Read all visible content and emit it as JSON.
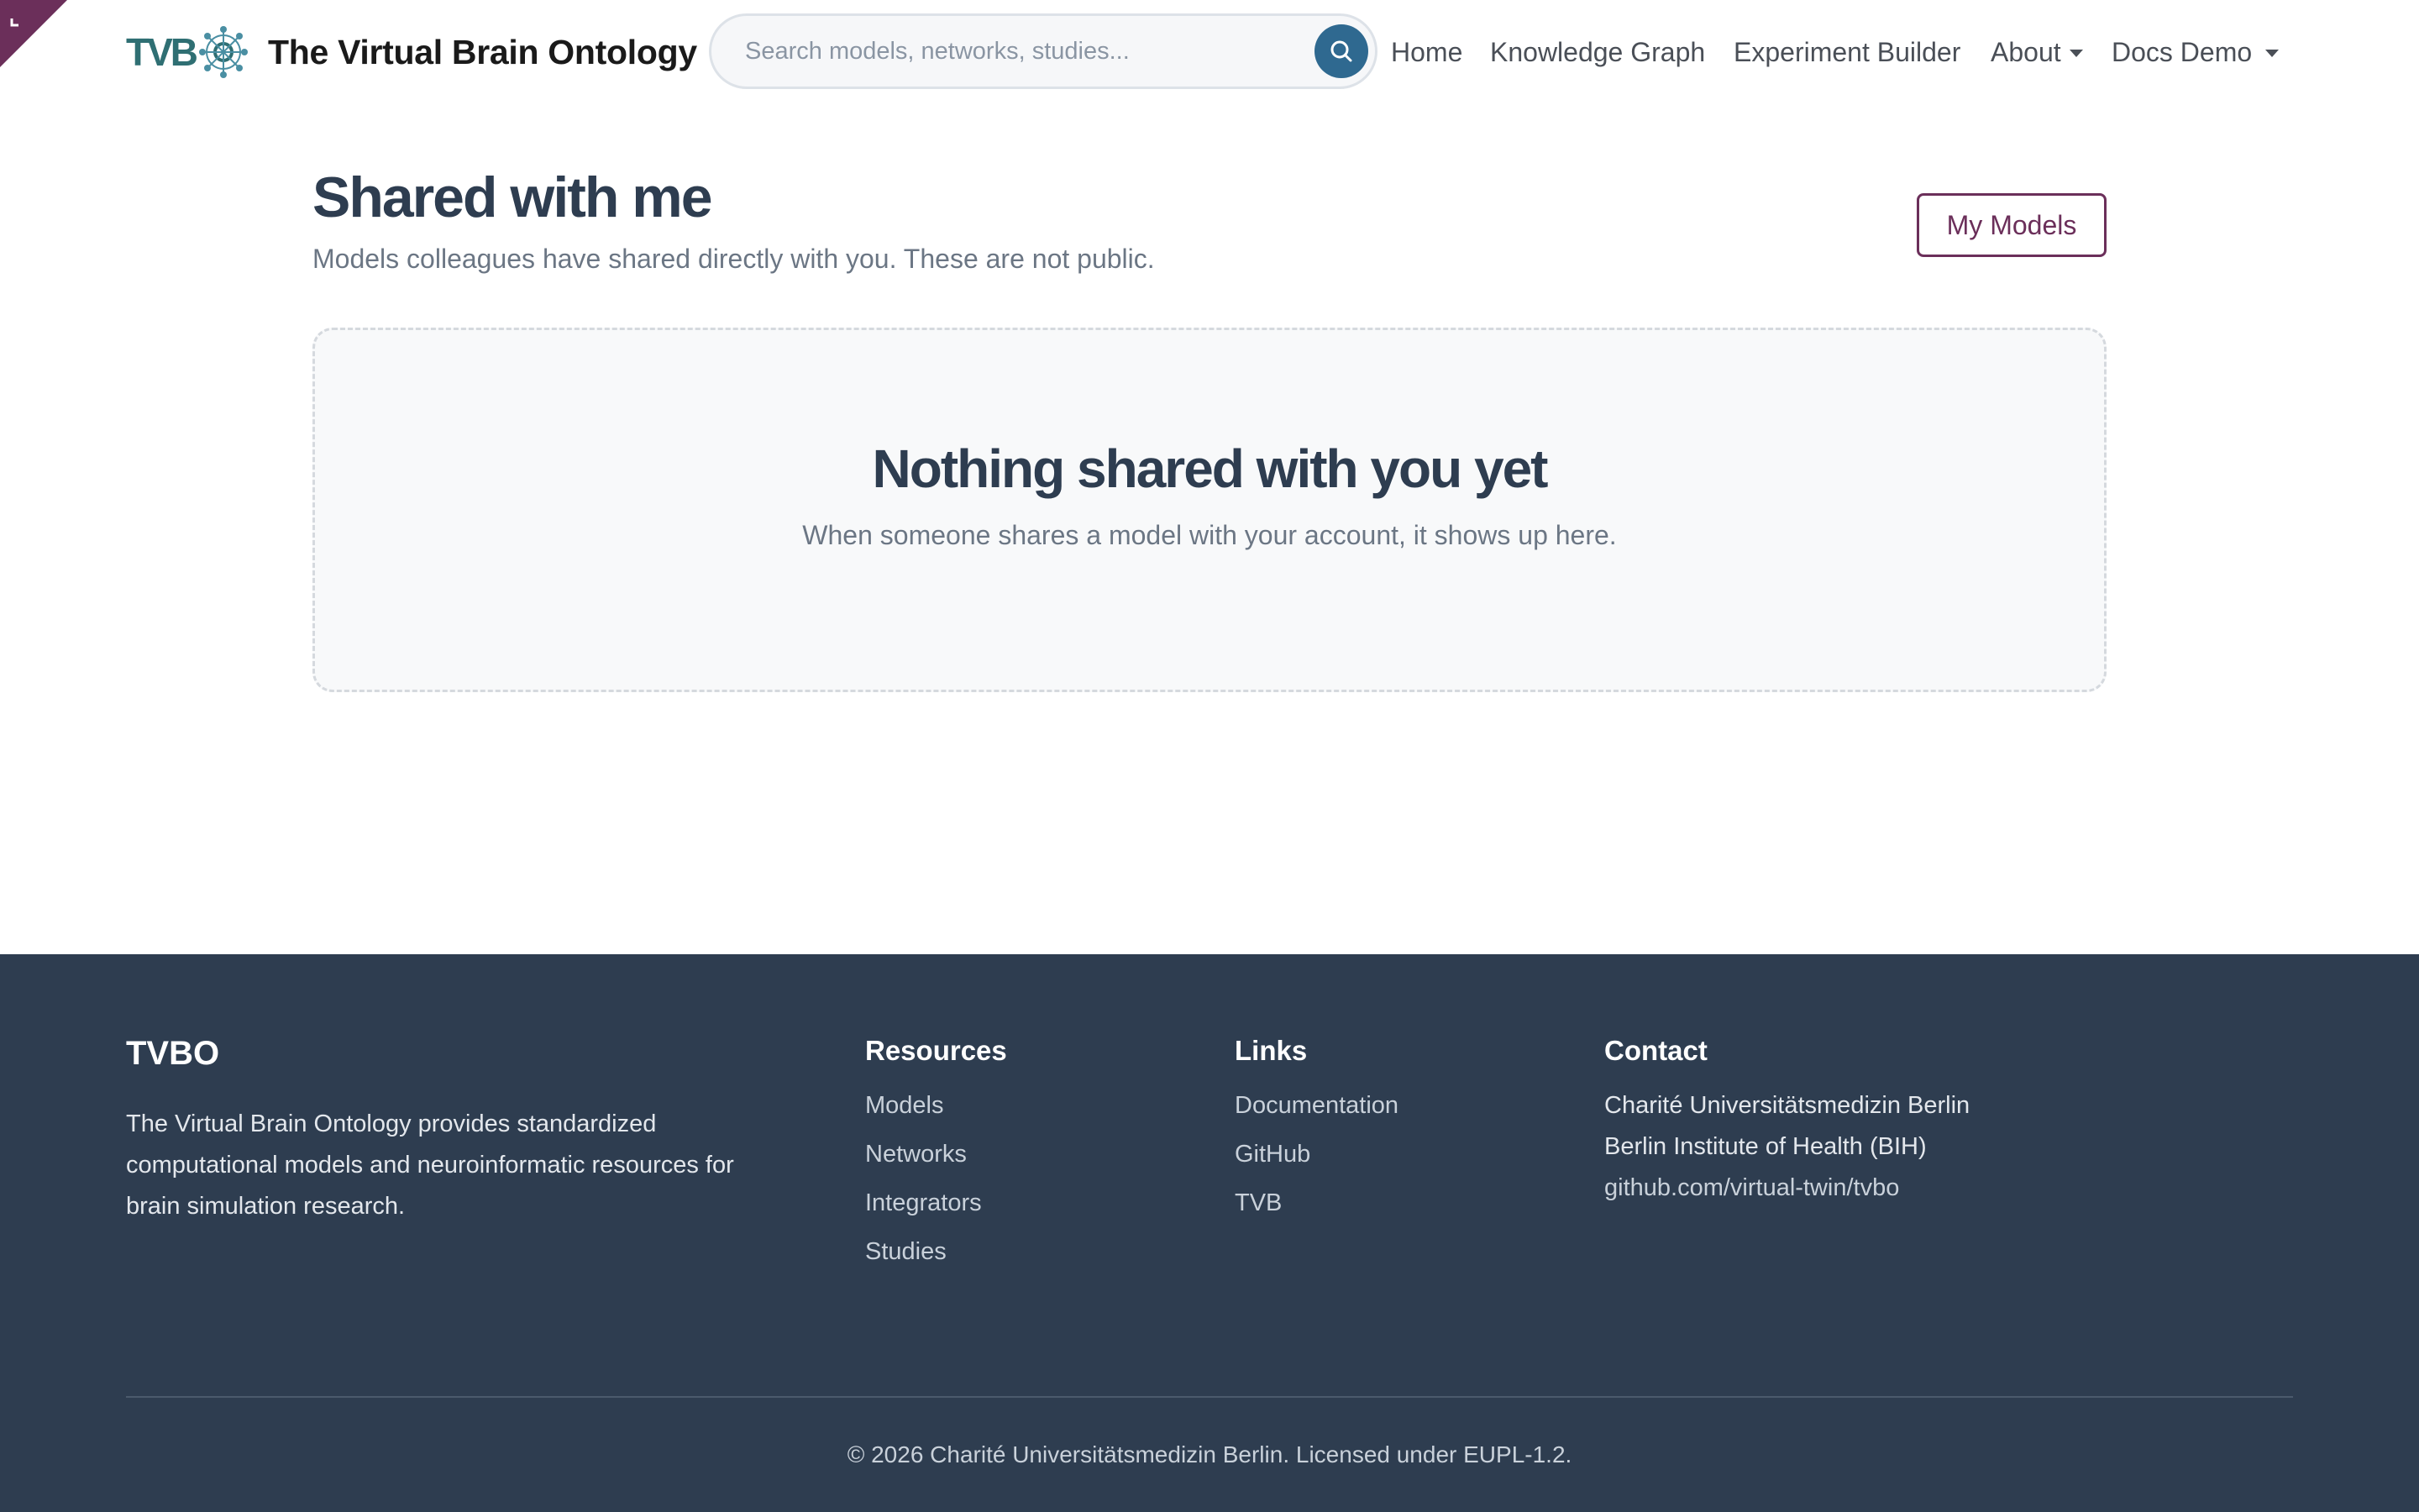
{
  "brand": {
    "logo_text": "TVB",
    "title": "The Virtual Brain Ontology"
  },
  "search": {
    "placeholder": "Search models, networks, studies...",
    "value": ""
  },
  "nav": {
    "items": [
      {
        "label": "Home"
      },
      {
        "label": "Knowledge Graph"
      },
      {
        "label": "Experiment Builder"
      },
      {
        "label": "About"
      },
      {
        "label": "Docs Demo"
      }
    ]
  },
  "main": {
    "title": "Shared with me",
    "subtitle": "Models colleagues have shared directly with you. These are not public.",
    "my_models_label": "My Models",
    "empty": {
      "title": "Nothing shared with you yet",
      "message": "When someone shares a model with your account, it shows up here."
    }
  },
  "footer": {
    "brand": "TVBO",
    "description": "The Virtual Brain Ontology provides standardized computational models and neuroinformatic resources for brain simulation research.",
    "resources": {
      "heading": "Resources",
      "links": [
        "Models",
        "Networks",
        "Integrators",
        "Studies"
      ]
    },
    "links": {
      "heading": "Links",
      "items": [
        "Documentation",
        "GitHub",
        "TVB"
      ]
    },
    "contact": {
      "heading": "Contact",
      "lines": [
        "Charité Universitätsmedizin Berlin",
        "Berlin Institute of Health (BIH)"
      ],
      "link": "github.com/virtual-twin/tvbo"
    },
    "copyright": "© 2026 Charité Universitätsmedizin Berlin. Licensed under EUPL-1.2."
  },
  "colors": {
    "accent": "#6b2f5a",
    "footer_bg": "#2e3d50",
    "search_button": "#2f6990",
    "logo_teal": "#2f6f73"
  },
  "icons": {
    "search_button": "search-icon",
    "logo": "brain-network-icon",
    "corner": "corner-marker-icon"
  }
}
